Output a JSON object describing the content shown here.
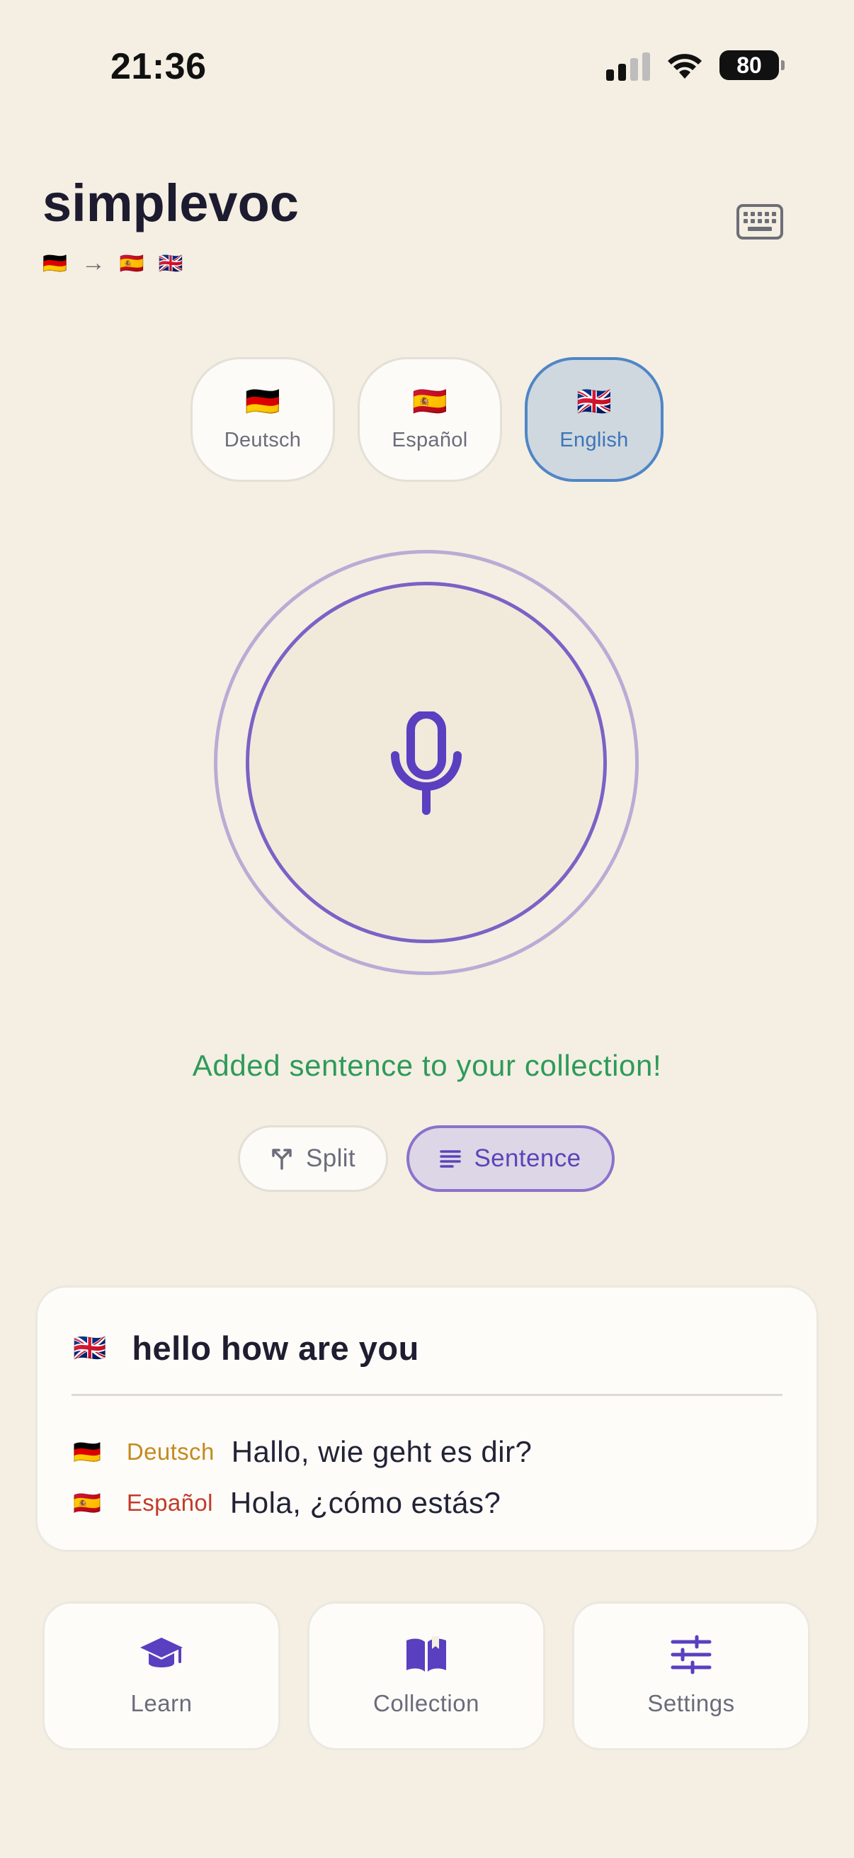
{
  "status_bar": {
    "time": "21:36",
    "battery": "80",
    "icons": [
      "signal-icon",
      "wifi-icon",
      "battery-icon"
    ]
  },
  "header": {
    "title": "simplevoc",
    "route": {
      "source_flag": "🇩🇪",
      "arrow": "→",
      "target_flags": [
        "🇪🇸",
        "🇬🇧"
      ]
    },
    "keyboard_icon": "keyboard-icon"
  },
  "languages": [
    {
      "flag": "🇩🇪",
      "label": "Deutsch",
      "selected": false
    },
    {
      "flag": "🇪🇸",
      "label": "Español",
      "selected": false
    },
    {
      "flag": "🇬🇧",
      "label": "English",
      "selected": true
    }
  ],
  "mic": {
    "icon": "microphone-icon",
    "accent": "#5a3fc0"
  },
  "status_message": "Added sentence to your collection!",
  "modes": {
    "split": {
      "label": "Split",
      "icon": "split-icon",
      "selected": false
    },
    "sentence": {
      "label": "Sentence",
      "icon": "text-lines-icon",
      "selected": true
    }
  },
  "result": {
    "source_flag": "🇬🇧",
    "source_text": "hello how are you",
    "translations": [
      {
        "flag": "🇩🇪",
        "language": "Deutsch",
        "text": "Hallo, wie geht es dir?"
      },
      {
        "flag": "🇪🇸",
        "language": "Español",
        "text": "Hola, ¿cómo estás?"
      }
    ]
  },
  "nav": [
    {
      "label": "Learn",
      "icon": "graduation-cap-icon"
    },
    {
      "label": "Collection",
      "icon": "open-book-icon"
    },
    {
      "label": "Settings",
      "icon": "sliders-icon"
    }
  ],
  "colors": {
    "background": "#f4efe2",
    "accent": "#5a3fc0",
    "success": "#2e9a5a",
    "selected_language_border": "#4f86c6",
    "deutsch_label": "#c48a1f",
    "espanol_label": "#c23a29"
  }
}
